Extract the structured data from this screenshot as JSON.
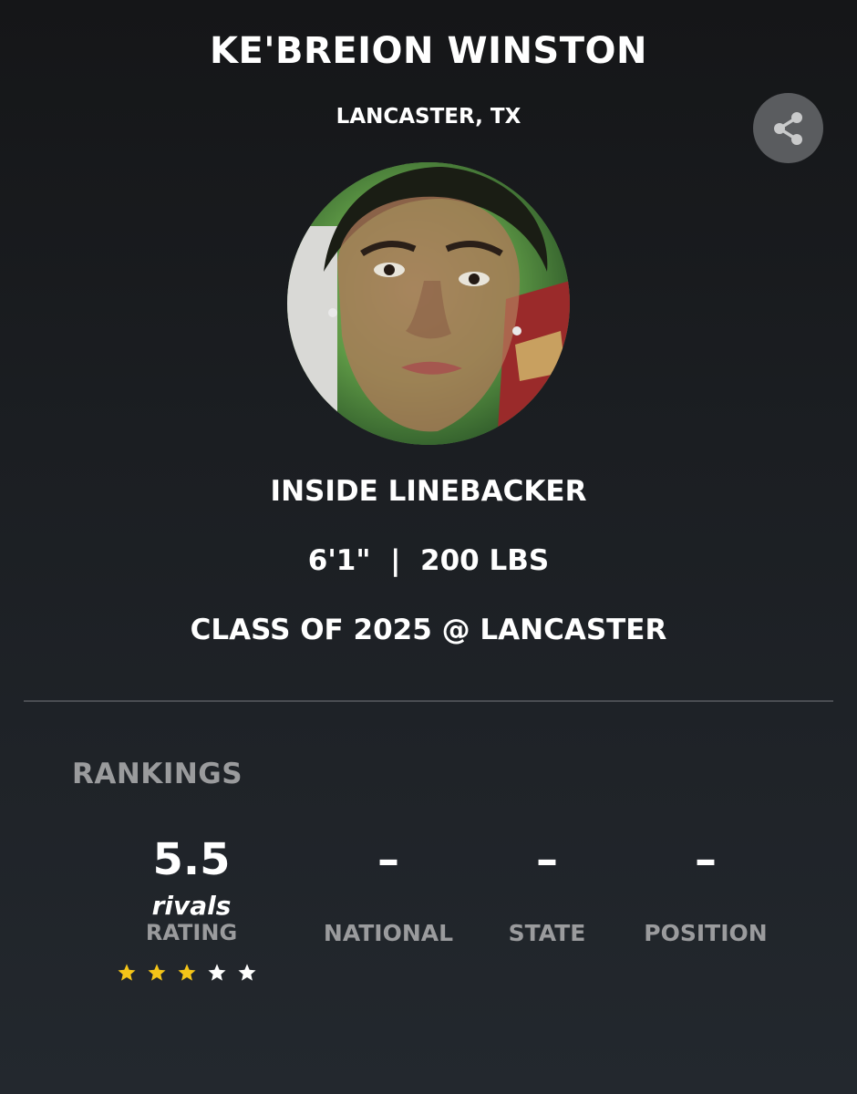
{
  "player": {
    "name": "KE'BREION WINSTON",
    "hometown": "LANCASTER, TX",
    "position": "INSIDE LINEBACKER",
    "measurables": "6'1\"  |  200 LBS",
    "class_line": "CLASS OF 2025 @ LANCASTER"
  },
  "share": {
    "icon": "share-icon"
  },
  "rankings": {
    "heading": "RANKINGS",
    "rating": {
      "value": "5.5",
      "brand": "rivals",
      "label": "RATING",
      "stars_filled": 3,
      "stars_total": 5,
      "star_color_filled": "#f5c518",
      "star_color_empty": "#ffffff"
    },
    "columns": [
      {
        "value": "–",
        "label": "NATIONAL"
      },
      {
        "value": "–",
        "label": "STATE"
      },
      {
        "value": "–",
        "label": "POSITION"
      }
    ]
  },
  "colors": {
    "background_top": "#151618",
    "background_bottom": "#23282e",
    "muted_text": "#9a9b9d",
    "share_button": "#5a5c5f"
  }
}
